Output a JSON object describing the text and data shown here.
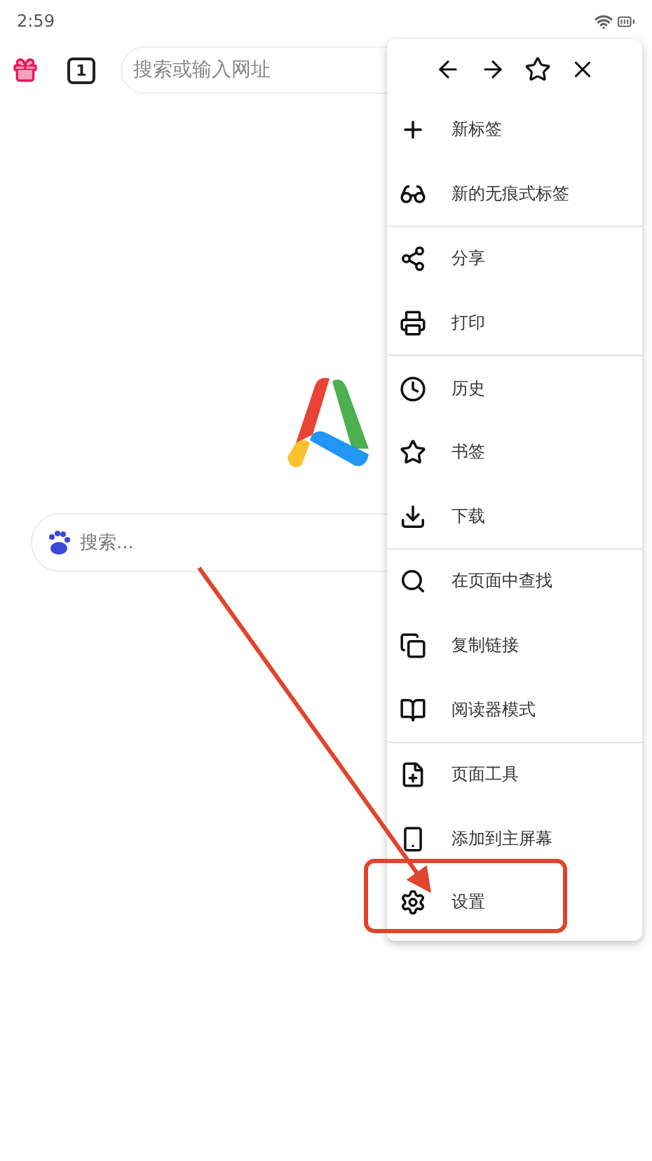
{
  "status_bar": {
    "time": "2:59"
  },
  "toolbar": {
    "tab_count": "1",
    "address_placeholder": "搜索或输入网址"
  },
  "home": {
    "search_placeholder": "搜索..."
  },
  "menu": {
    "groups": [
      {
        "items": [
          {
            "kind": "new-tab",
            "label": "新标签"
          },
          {
            "kind": "incognito",
            "label": "新的无痕式标签"
          }
        ]
      },
      {
        "items": [
          {
            "kind": "share",
            "label": "分享"
          },
          {
            "kind": "print",
            "label": "打印"
          }
        ]
      },
      {
        "items": [
          {
            "kind": "history",
            "label": "历史"
          },
          {
            "kind": "bookmarks",
            "label": "书签"
          },
          {
            "kind": "downloads",
            "label": "下载"
          }
        ]
      },
      {
        "items": [
          {
            "kind": "find",
            "label": "在页面中查找"
          },
          {
            "kind": "copy-link",
            "label": "复制链接"
          },
          {
            "kind": "reader",
            "label": "阅读器模式"
          }
        ]
      },
      {
        "items": [
          {
            "kind": "page-tools",
            "label": "页面工具"
          },
          {
            "kind": "add-home",
            "label": "添加到主屏幕"
          },
          {
            "kind": "settings",
            "label": "设置"
          }
        ]
      }
    ]
  }
}
